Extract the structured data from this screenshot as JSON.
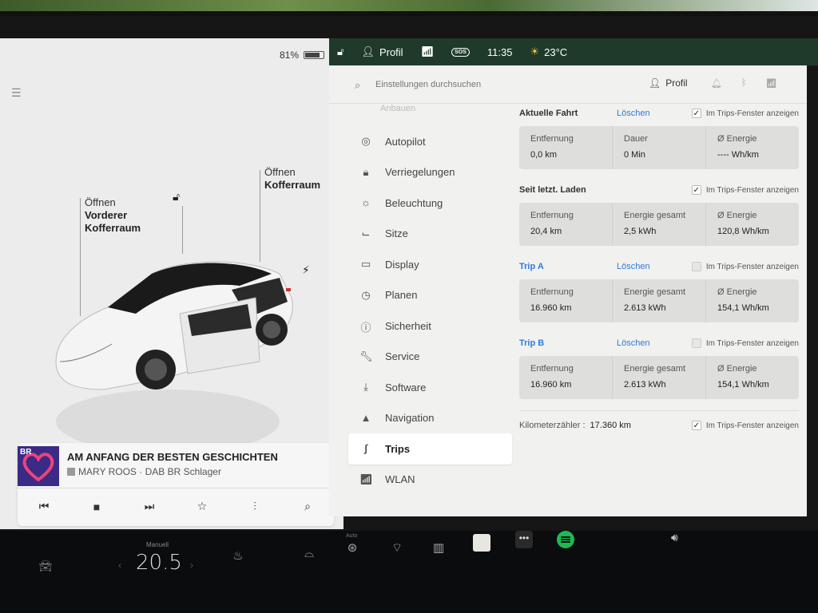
{
  "left_panel": {
    "battery_percent": "81%",
    "battery_level": 0.81,
    "callouts": {
      "frunk_line1": "Öffnen",
      "frunk_line2": "Vorderer",
      "frunk_line3": "Kofferraum",
      "trunk_line1": "Öffnen",
      "trunk_line2": "Kofferraum"
    },
    "media": {
      "album_badge": "BR",
      "title": "AM ANFANG DER BESTEN GESCHICHTEN",
      "artist": "MARY ROOS · DAB BR Schlager"
    }
  },
  "status_bar": {
    "profile_label": "Profil",
    "time": "11:35",
    "temperature": "23°C",
    "sos_label": "SOS"
  },
  "settings": {
    "search_placeholder": "Einstellungen durchsuchen",
    "profile_label": "Profil",
    "menu_partial_top": "Anbauen",
    "menu": [
      {
        "label": "Autopilot",
        "icon": "steering-wheel-icon"
      },
      {
        "label": "Verriegelungen",
        "icon": "lock-icon"
      },
      {
        "label": "Beleuchtung",
        "icon": "light-icon"
      },
      {
        "label": "Sitze",
        "icon": "seat-icon"
      },
      {
        "label": "Display",
        "icon": "display-icon"
      },
      {
        "label": "Planen",
        "icon": "clock-icon"
      },
      {
        "label": "Sicherheit",
        "icon": "safety-icon"
      },
      {
        "label": "Service",
        "icon": "wrench-icon"
      },
      {
        "label": "Software",
        "icon": "download-icon"
      },
      {
        "label": "Navigation",
        "icon": "navigation-icon"
      },
      {
        "label": "Trips",
        "icon": "trips-icon"
      },
      {
        "label": "WLAN",
        "icon": "wifi-icon"
      }
    ],
    "active_item": "Trips",
    "show_in_trips_label": "Im Trips-Fenster anzeigen",
    "clear_label": "Löschen",
    "current_drive": {
      "title": "Aktuelle Fahrt",
      "show": true,
      "stats": [
        {
          "label": "Entfernung",
          "value": "0,0 km"
        },
        {
          "label": "Dauer",
          "value": "0 Min"
        },
        {
          "label": "Ø Energie",
          "value": "---- Wh/km"
        }
      ]
    },
    "since_charge": {
      "title": "Seit letzt. Laden",
      "show": true,
      "stats": [
        {
          "label": "Entfernung",
          "value": "20,4 km"
        },
        {
          "label": "Energie gesamt",
          "value": "2,5 kWh"
        },
        {
          "label": "Ø Energie",
          "value": "120,8 Wh/km"
        }
      ]
    },
    "trip_a": {
      "title": "Trip A",
      "show": false,
      "stats": [
        {
          "label": "Entfernung",
          "value": "16.960 km"
        },
        {
          "label": "Energie gesamt",
          "value": "2.613 kWh"
        },
        {
          "label": "Ø Energie",
          "value": "154,1 Wh/km"
        }
      ]
    },
    "trip_b": {
      "title": "Trip B",
      "show": false,
      "stats": [
        {
          "label": "Entfernung",
          "value": "16.960 km"
        },
        {
          "label": "Energie gesamt",
          "value": "2.613 kWh"
        },
        {
          "label": "Ø Energie",
          "value": "154,1 Wh/km"
        }
      ]
    },
    "odometer": {
      "label": "Kilometerzähler :",
      "value": "17.360 km",
      "show": true
    }
  },
  "bottom_bar": {
    "temp_mode": "Manuell",
    "temp_value": "20.5",
    "wiper_mode": "Auto"
  },
  "colors": {
    "accent_blue": "#2e7bd6",
    "statusbar_bg": "#1f3a2a",
    "spotify_green": "#1db954"
  }
}
